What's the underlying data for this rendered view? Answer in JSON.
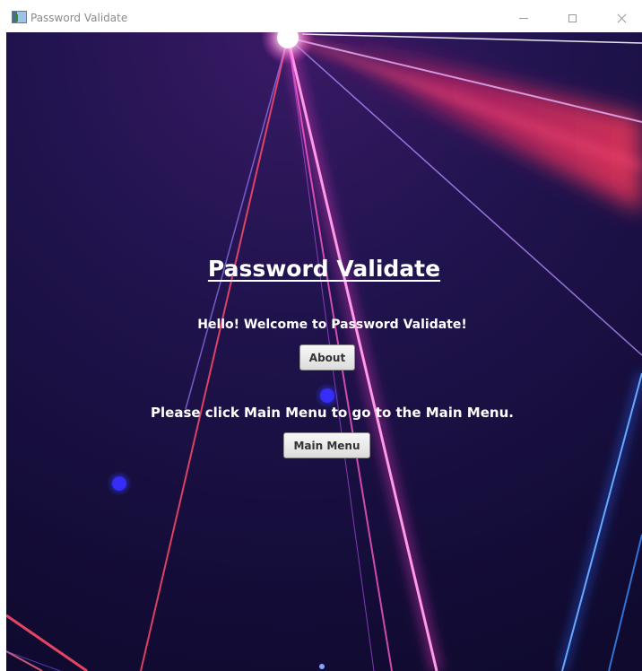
{
  "window": {
    "title": "Password Validate"
  },
  "main": {
    "heading": "Password Validate",
    "welcome_text": "Hello! Welcome to Password Validate!",
    "about_label": "About",
    "instruction_text": "Please click Main Menu to go to the Main Menu.",
    "main_menu_label": "Main Menu"
  },
  "colors": {
    "background": "#1a1040",
    "text": "#ffffff",
    "button": "#e8e8e8"
  }
}
